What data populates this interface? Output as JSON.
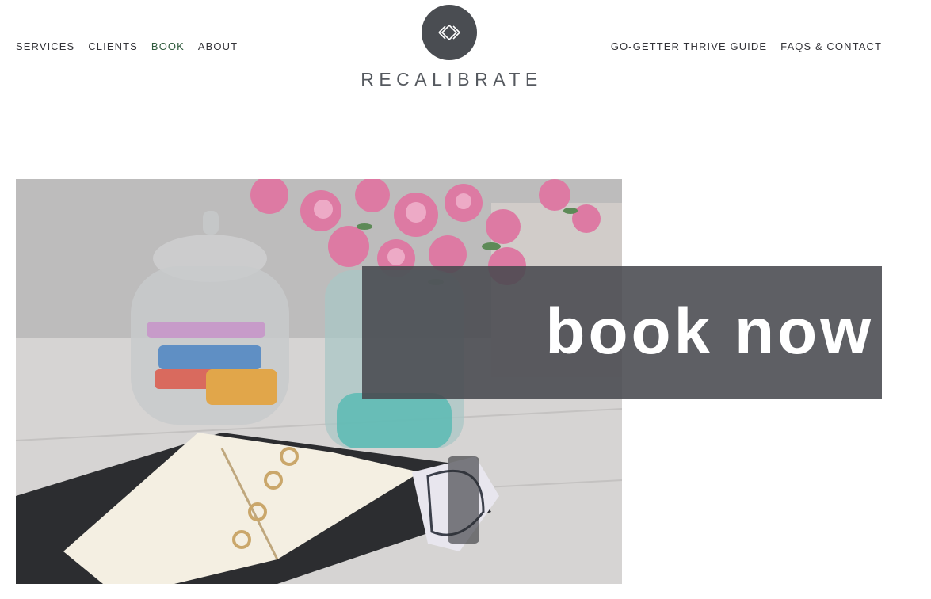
{
  "nav": {
    "left": [
      {
        "label": "SERVICES"
      },
      {
        "label": "CLIENTS"
      },
      {
        "label": "BOOK"
      },
      {
        "label": "ABOUT"
      }
    ],
    "right": [
      {
        "label": "GO-GETTER THRIVE GUIDE"
      },
      {
        "label": "FAQS & CONTACT"
      }
    ],
    "active_item": "BOOK"
  },
  "logo": {
    "text": "RECALIBRATE",
    "icon": "diamond-arrows-icon"
  },
  "hero": {
    "image": "planner-and-carnations-photo",
    "cta_label": "book now"
  },
  "colors": {
    "text": "#333338",
    "active_nav": "#2f5a3c",
    "logo_circle": "#4a4d52",
    "cta_overlay": "#48494e"
  }
}
